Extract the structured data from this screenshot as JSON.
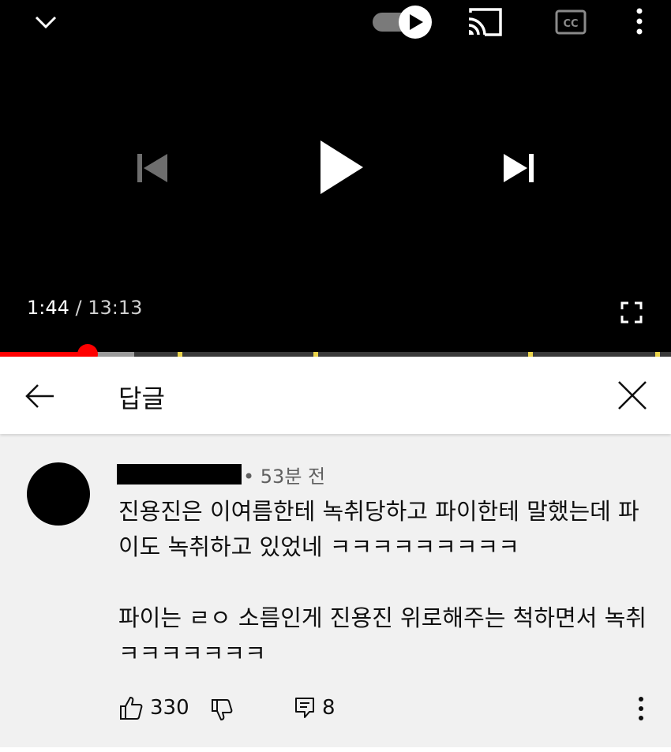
{
  "player": {
    "current_time": "1:44",
    "separator": " / ",
    "duration": "13:13",
    "progress_fraction": 0.13,
    "buffered_fraction": 0.2,
    "chapter_marker_fractions": [
      0.268,
      0.47,
      0.79,
      0.98
    ],
    "icons": {
      "minimize": "chevron-down-icon",
      "autoplay": "autoplay-toggle-icon",
      "cast": "cast-icon",
      "captions": "cc-icon",
      "more": "more-vert-icon",
      "previous": "skip-previous-icon",
      "play": "play-icon",
      "next": "skip-next-icon",
      "fullscreen": "fullscreen-icon"
    },
    "colors": {
      "progress": "#ff0000",
      "background": "#000000",
      "marker": "#e9d34a"
    }
  },
  "replies_panel": {
    "title": "답글",
    "icons": {
      "back": "arrow-back-icon",
      "close": "close-icon"
    }
  },
  "comment": {
    "meta": "• 53분 전",
    "paragraphs": [
      "진용진은 이여름한테 녹취당하고 파이한테 말했는데 파이도 녹취하고 있었네 ㅋㅋㅋㅋㅋㅋㅋㅋㅋ",
      "파이는 ㄹㅇ 소름인게 진용진 위로해주는 척하면서 녹취 ㅋㅋㅋㅋㅋㅋㅋ"
    ],
    "like_count": "330",
    "reply_count": "8",
    "icons": {
      "like": "thumb-up-icon",
      "dislike": "thumb-down-icon",
      "reply": "reply-icon",
      "more": "more-vert-icon"
    }
  }
}
